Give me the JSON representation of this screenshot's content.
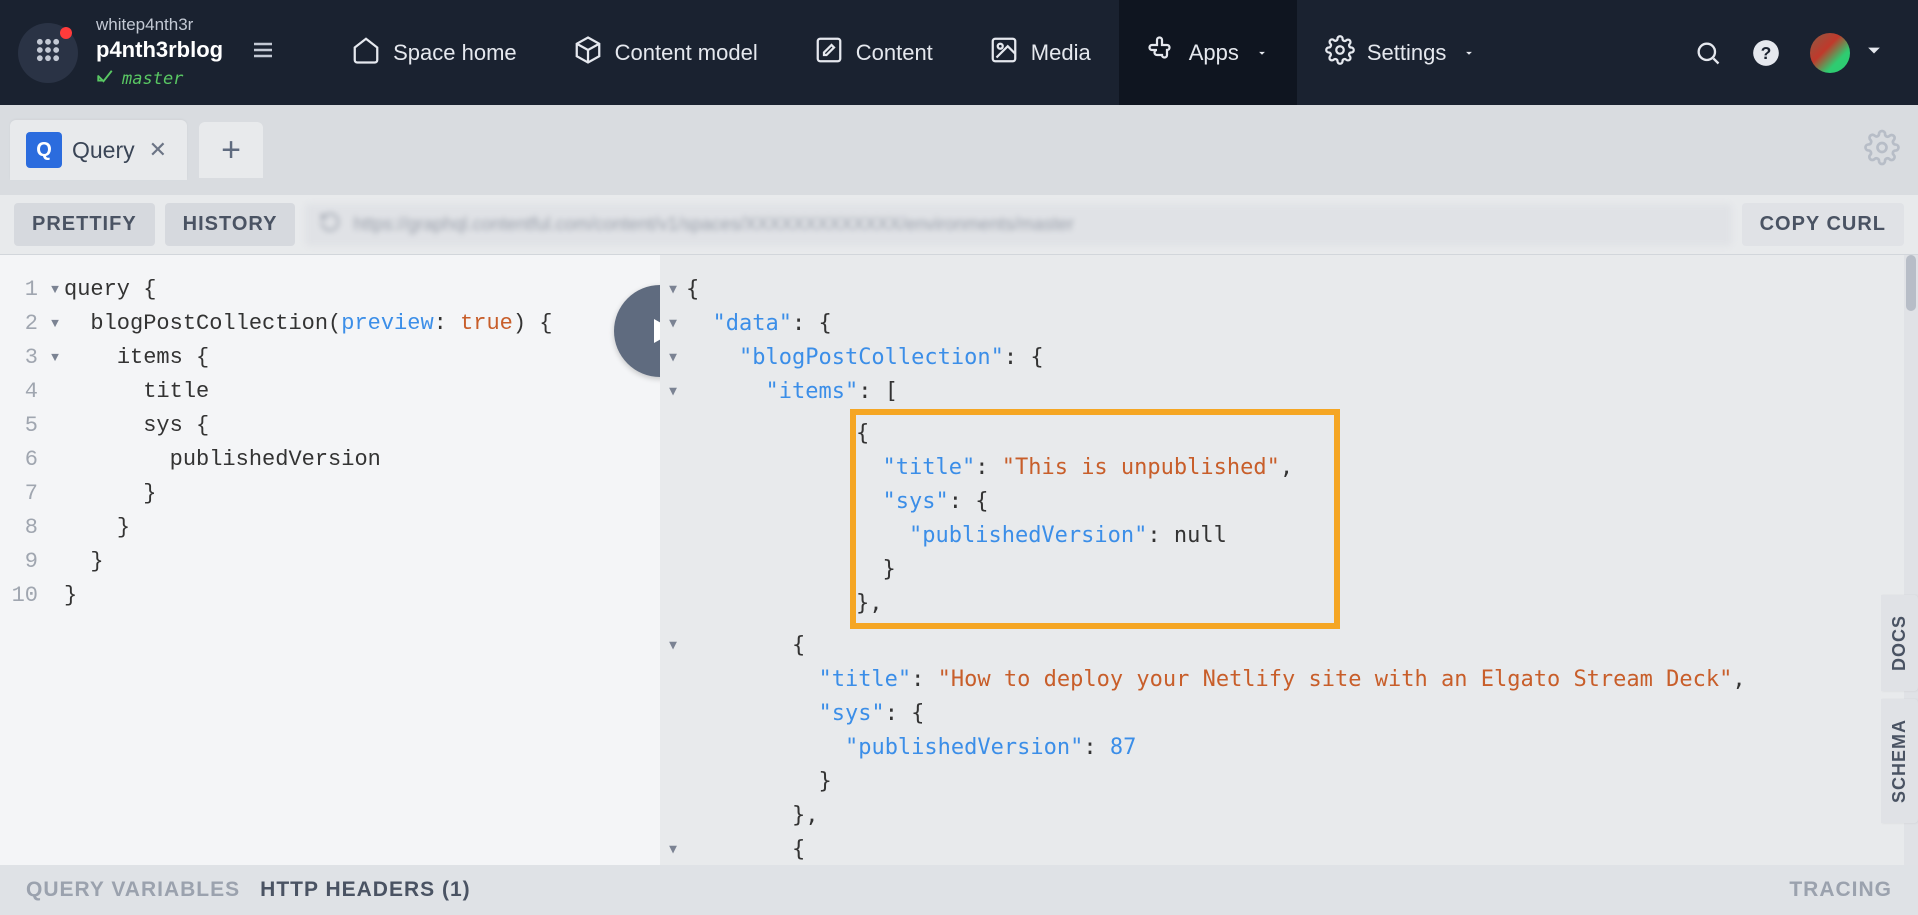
{
  "topnav": {
    "user": "whitep4nth3r",
    "space": "p4nth3rblog",
    "branch": "master",
    "items": [
      {
        "label": "Space home",
        "active": false
      },
      {
        "label": "Content model",
        "active": false
      },
      {
        "label": "Content",
        "active": false
      },
      {
        "label": "Media",
        "active": false
      },
      {
        "label": "Apps",
        "active": true,
        "has_dropdown": true
      },
      {
        "label": "Settings",
        "active": false,
        "has_dropdown": true
      }
    ]
  },
  "tabs": {
    "active": {
      "badge": "Q",
      "title": "Query"
    }
  },
  "toolbar": {
    "prettify": "PRETTIFY",
    "history": "HISTORY",
    "copy_curl": "COPY CURL",
    "url_blurred": "https://graphql.contentful.com/content/v1/spaces/XXXXXXXXXXXXX/environments/master"
  },
  "query_editor": {
    "lines": [
      {
        "n": 1,
        "fold": true,
        "pre": "",
        "tokens": [
          [
            "kw",
            "query "
          ],
          [
            "punct",
            "{"
          ]
        ]
      },
      {
        "n": 2,
        "fold": true,
        "pre": "  ",
        "tokens": [
          [
            "fn",
            "blogPostCollection"
          ],
          [
            "punct",
            "("
          ],
          [
            "arg",
            "preview"
          ],
          [
            "punct",
            ": "
          ],
          [
            "val",
            "true"
          ],
          [
            "punct",
            ") {"
          ]
        ]
      },
      {
        "n": 3,
        "fold": true,
        "pre": "    ",
        "tokens": [
          [
            "fn",
            "items "
          ],
          [
            "punct",
            "{"
          ]
        ]
      },
      {
        "n": 4,
        "fold": false,
        "pre": "      ",
        "tokens": [
          [
            "fn",
            "title"
          ]
        ]
      },
      {
        "n": 5,
        "fold": false,
        "pre": "      ",
        "tokens": [
          [
            "fn",
            "sys "
          ],
          [
            "punct",
            "{"
          ]
        ]
      },
      {
        "n": 6,
        "fold": false,
        "pre": "        ",
        "tokens": [
          [
            "fn",
            "publishedVersion"
          ]
        ]
      },
      {
        "n": 7,
        "fold": false,
        "pre": "      ",
        "tokens": [
          [
            "punct",
            "}"
          ]
        ]
      },
      {
        "n": 8,
        "fold": false,
        "pre": "    ",
        "tokens": [
          [
            "punct",
            "}"
          ]
        ]
      },
      {
        "n": 9,
        "fold": false,
        "pre": "  ",
        "tokens": [
          [
            "punct",
            "}"
          ]
        ]
      },
      {
        "n": 10,
        "fold": false,
        "pre": "",
        "tokens": [
          [
            "punct",
            "}"
          ]
        ]
      }
    ]
  },
  "result": {
    "lines": [
      {
        "fold": true,
        "pre": "",
        "tokens": [
          [
            "punct",
            "{"
          ]
        ]
      },
      {
        "fold": true,
        "pre": "  ",
        "tokens": [
          [
            "key",
            "\"data\""
          ],
          [
            "punct",
            ": {"
          ]
        ]
      },
      {
        "fold": true,
        "pre": "    ",
        "tokens": [
          [
            "key",
            "\"blogPostCollection\""
          ],
          [
            "punct",
            ": {"
          ]
        ]
      },
      {
        "fold": true,
        "pre": "      ",
        "tokens": [
          [
            "key",
            "\"items\""
          ],
          [
            "punct",
            ": ["
          ]
        ]
      },
      {
        "fold": true,
        "pre": "        ",
        "tokens": [
          [
            "punct",
            "{"
          ]
        ],
        "hl_start": true
      },
      {
        "fold": false,
        "pre": "          ",
        "tokens": [
          [
            "key",
            "\"title\""
          ],
          [
            "punct",
            ": "
          ],
          [
            "str",
            "\"This is unpublished\""
          ],
          [
            "punct",
            ","
          ]
        ]
      },
      {
        "fold": false,
        "pre": "          ",
        "tokens": [
          [
            "key",
            "\"sys\""
          ],
          [
            "punct",
            ": {"
          ]
        ]
      },
      {
        "fold": false,
        "pre": "            ",
        "tokens": [
          [
            "key",
            "\"publishedVersion\""
          ],
          [
            "punct",
            ": "
          ],
          [
            "nullv",
            "null"
          ]
        ]
      },
      {
        "fold": false,
        "pre": "          ",
        "tokens": [
          [
            "punct",
            "}"
          ]
        ]
      },
      {
        "fold": false,
        "pre": "        ",
        "tokens": [
          [
            "punct",
            "},"
          ]
        ],
        "hl_end": true
      },
      {
        "fold": true,
        "pre": "        ",
        "tokens": [
          [
            "punct",
            "{"
          ]
        ]
      },
      {
        "fold": false,
        "pre": "          ",
        "tokens": [
          [
            "key",
            "\"title\""
          ],
          [
            "punct",
            ": "
          ],
          [
            "str",
            "\"How to deploy your Netlify site with an Elgato Stream Deck\""
          ],
          [
            "punct",
            ","
          ]
        ]
      },
      {
        "fold": false,
        "pre": "          ",
        "tokens": [
          [
            "key",
            "\"sys\""
          ],
          [
            "punct",
            ": {"
          ]
        ]
      },
      {
        "fold": false,
        "pre": "            ",
        "tokens": [
          [
            "key",
            "\"publishedVersion\""
          ],
          [
            "punct",
            ": "
          ],
          [
            "num",
            "87"
          ]
        ]
      },
      {
        "fold": false,
        "pre": "          ",
        "tokens": [
          [
            "punct",
            "}"
          ]
        ]
      },
      {
        "fold": false,
        "pre": "        ",
        "tokens": [
          [
            "punct",
            "},"
          ]
        ]
      },
      {
        "fold": true,
        "pre": "        ",
        "tokens": [
          [
            "punct",
            "{"
          ]
        ]
      }
    ]
  },
  "bottom": {
    "query_vars": "QUERY VARIABLES",
    "http_headers": "HTTP HEADERS (1)",
    "tracing": "TRACING"
  },
  "sidetabs": {
    "docs": "DOCS",
    "schema": "SCHEMA"
  }
}
